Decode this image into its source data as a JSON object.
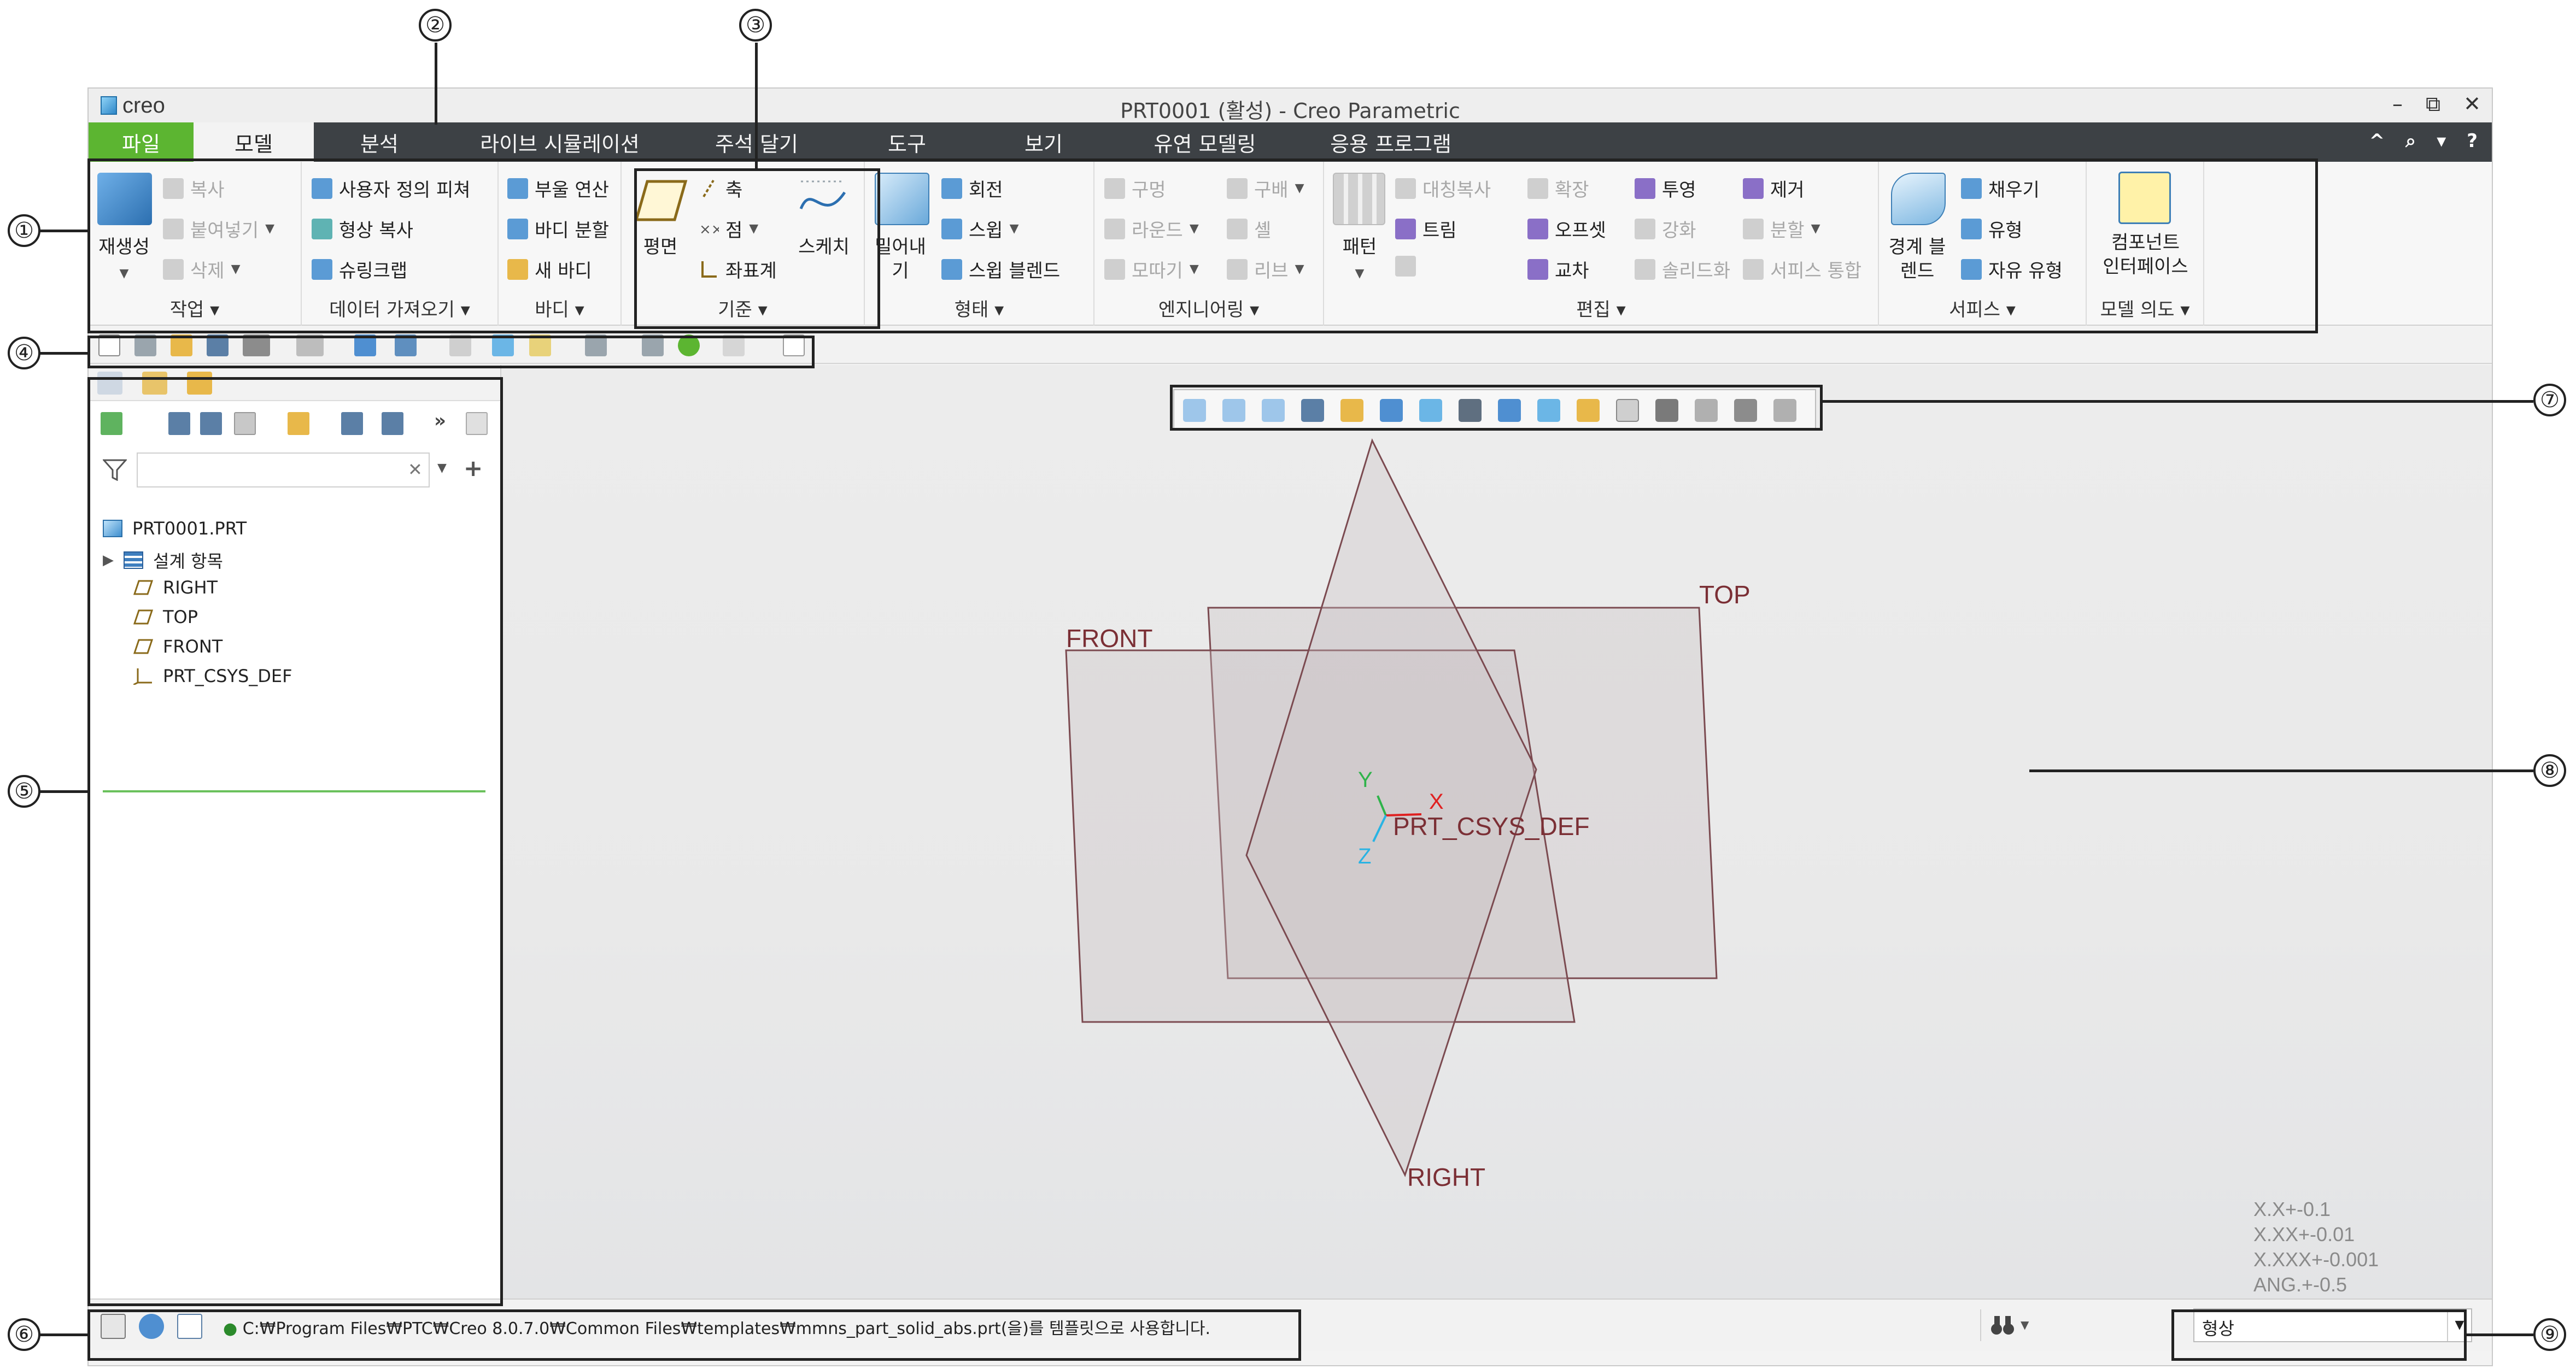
{
  "window": {
    "app_logo": "creo",
    "title": "PRT0001 (활성) - Creo Parametric",
    "controls": [
      "–",
      "⧉",
      "✕"
    ]
  },
  "tabs": [
    "파일",
    "모델",
    "분석",
    "라이브 시뮬레이션",
    "주석 달기",
    "도구",
    "보기",
    "유연 모델링",
    "응용 프로그램"
  ],
  "active_tab": "모델",
  "tab_tools": [
    "^",
    "⌕",
    "▾",
    "?"
  ],
  "ribbon": {
    "operations": {
      "label": "작업 ▾",
      "regenerate": "재생성",
      "copy": "복사",
      "paste": "붙여넣기",
      "delete": "삭제"
    },
    "get_data": {
      "label": "데이터 가져오기 ▾",
      "udf": "사용자 정의 피쳐",
      "copy_geom": "형상 복사",
      "shrinkwrap": "슈링크랩"
    },
    "body": {
      "label": "바디 ▾",
      "boolean": "부울 연산",
      "split_body": "바디 분할",
      "new_body": "새 바디"
    },
    "datum": {
      "label": "기준 ▾",
      "plane": "평면",
      "axis": "축",
      "point": "점",
      "csys": "좌표계",
      "sketch": "스케치"
    },
    "shapes": {
      "label": "형태 ▾",
      "extrude_line1": "밀어내",
      "extrude_line2": "기",
      "revolve": "회전",
      "sweep": "스윕",
      "swept_blend": "스윕 블렌드"
    },
    "engineering": {
      "label": "엔지니어링 ▾",
      "hole": "구멍",
      "round": "라운드",
      "chamfer": "모따기",
      "draft": "구배",
      "shell": "셸",
      "rib": "리브"
    },
    "editing": {
      "label": "편집 ▾",
      "pattern": "패턴",
      "mirror": "대칭복사",
      "trim": "트림",
      "extend": "확장",
      "offset": "오프셋",
      "intersect": "교차",
      "project": "투영",
      "thicken": "강화",
      "solidify": "솔리드화",
      "remove": "제거",
      "split": "분할",
      "merge_surfaces": "서피스 통합"
    },
    "surfaces": {
      "label": "서피스 ▾",
      "boundary_line1": "경계 블",
      "boundary_line2": "렌드",
      "fill": "채우기",
      "style": "유형",
      "freestyle": "자유 유형"
    },
    "model_intent": {
      "label": "모델 의도 ▾",
      "comp_if_line1": "컴포넌트",
      "comp_if_line2": "인터페이스"
    }
  },
  "model_tree": {
    "filter_placeholder": "",
    "clear_symbol": "✕",
    "add_symbol": "+",
    "expand_symbol": "»",
    "items": [
      {
        "label": "PRT0001.PRT",
        "icon": "part-icon"
      },
      {
        "label": "설계 항목",
        "icon": "design-items-icon"
      },
      {
        "label": "RIGHT",
        "icon": "datum-plane-icon"
      },
      {
        "label": "TOP",
        "icon": "datum-plane-icon"
      },
      {
        "label": "FRONT",
        "icon": "datum-plane-icon"
      },
      {
        "label": "PRT_CSYS_DEF",
        "icon": "csys-icon"
      }
    ]
  },
  "graphics": {
    "datum_labels": {
      "front": "FRONT",
      "top": "TOP",
      "right": "RIGHT",
      "csys": "PRT_CSYS_DEF"
    },
    "axes": {
      "x": "X",
      "y": "Y",
      "z": "Z"
    },
    "tolerances": [
      "X.X+-0.1",
      "X.XX+-0.01",
      "X.XXX+-0.001",
      "ANG.+-0.5"
    ]
  },
  "status": {
    "message": "C:₩Program Files₩PTC₩Creo 8.0.7.0₩Common Files₩templates₩mmns_part_solid_abs.prt(을)를 템플릿으로 사용합니다.",
    "selection_filter": "형상"
  },
  "callouts": [
    "①",
    "②",
    "③",
    "④",
    "⑤",
    "⑥",
    "⑦",
    "⑧",
    "⑨"
  ],
  "colors": {
    "file_tab": "#5cb531",
    "tab_bar": "#3d4145",
    "datum_plane": "#7b2f35",
    "axis_x": "#e02020",
    "axis_y": "#2fb34a",
    "axis_z": "#29b3e3"
  }
}
